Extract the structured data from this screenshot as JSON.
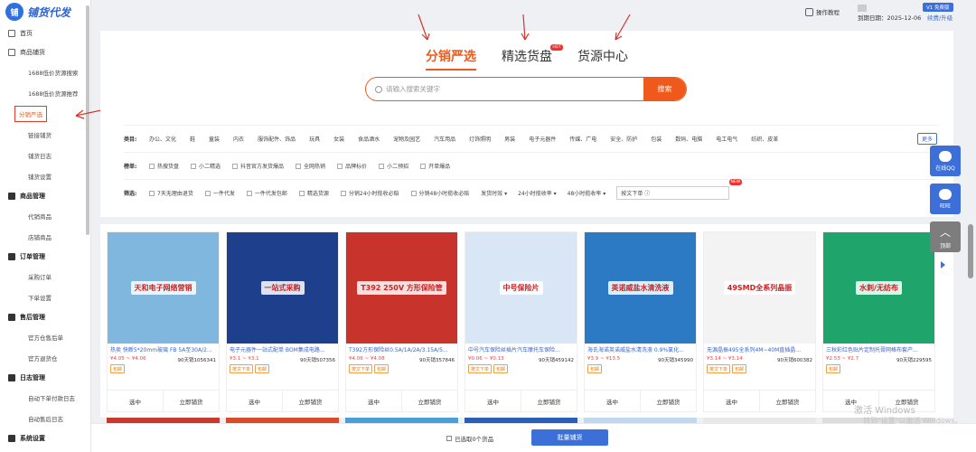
{
  "app": {
    "logo_mark": "铺",
    "name": "铺货代发"
  },
  "sidebar": {
    "home": "首页",
    "sections": [
      {
        "label": "商品铺货",
        "items": [
          "1688低价货源搜索",
          "1688低价货源推荐",
          "分销严选",
          "链接铺货",
          "铺货日志",
          "铺货设置"
        ]
      },
      {
        "label": "商品管理",
        "items": [
          "代销商品",
          "店铺商品"
        ]
      },
      {
        "label": "订单管理",
        "items": [
          "采购订单",
          "下单设置"
        ]
      },
      {
        "label": "售后管理",
        "items": [
          "官方仓售后单",
          "官方退货仓"
        ]
      },
      {
        "label": "日志管理",
        "items": [
          "自动下单付款日志",
          "自动售后日志"
        ]
      },
      {
        "label": "系统设置",
        "items": []
      }
    ]
  },
  "topbar": {
    "help": "操作教程",
    "expiry": "到期日期：2025-12-06",
    "version": "V1 免费版",
    "renew": "续费/升级"
  },
  "tabs": [
    {
      "label": "分销严选",
      "active": true
    },
    {
      "label": "精选货盘",
      "badge": "HOT"
    },
    {
      "label": "货源中心"
    }
  ],
  "search": {
    "placeholder": "请输入搜索关键字",
    "button": "搜索"
  },
  "filters": {
    "category_label": "类目:",
    "categories": [
      "办公、文化",
      "鞋",
      "童装",
      "内衣",
      "服饰配件、饰品",
      "玩具",
      "女装",
      "食品酒水",
      "宠物及园艺",
      "汽车用品",
      "灯饰照明",
      "男装",
      "电子元器件",
      "传媒、广电",
      "安全、防护",
      "包装",
      "数码、电脑",
      "电工电气",
      "纺织、皮革"
    ],
    "more": "更多",
    "list_label": "榜单:",
    "lists": [
      "热搜货盘",
      "小二精选",
      "抖音官方发货爆品",
      "全网热销",
      "品牌标价",
      "小二预招",
      "开单爆品"
    ],
    "filter_label": "筛选:",
    "options": [
      "7天无理由退货",
      "一件代发",
      "一件代发包邮",
      "精选货源",
      "分销24小时揽收必赔",
      "分销48小时揽收必赔"
    ],
    "selects": [
      "发货时效",
      "24小时揽收率",
      "48小时揽收率"
    ],
    "sort": "按文下单",
    "sort_badge": "NEW"
  },
  "products": [
    {
      "title": "热卖 快断5*20mm玻璃 FB 5A至30A/2...",
      "price": "¥4.05 ~ ¥4.06",
      "sales": "90天销1056341",
      "tags": [
        "包邮"
      ],
      "img_text": "天和电子网络营销",
      "bg": "#7fb7df"
    },
    {
      "title": "电子元器件一站式配单 BOM集成电路...",
      "price": "¥3.1 ~ ¥3.1",
      "sales": "90天销507356",
      "tags": [
        "按文下单",
        "包邮"
      ],
      "img_text": "一站式采购",
      "bg": "#1e3f8c"
    },
    {
      "title": "T392方形保险丝0.5A/1A/2A/3.15A/5...",
      "price": "¥4.06 ~ ¥4.08",
      "sales": "90天销357846",
      "tags": [
        "按文下单",
        "包邮"
      ],
      "img_text": "T392 250V 方形保险管",
      "bg": "#c8332b"
    },
    {
      "title": "中号汽车保险丝插片汽车摩托车保险...",
      "price": "¥0.06 ~ ¥0.13",
      "sales": "90天销459142",
      "tags": [
        "按文下单",
        "包邮"
      ],
      "img_text": "中号保险片",
      "bg": "#d9e6f5"
    },
    {
      "title": "海氏海诺英诺威盐水清洗液 0.9%氯化...",
      "price": "¥3.9 ~ ¥13.5",
      "sales": "90天销345990",
      "tags": [
        "包邮"
      ],
      "img_text": "英诺威盐水清洗液",
      "bg": "#2c79c4"
    },
    {
      "title": "无源晶振495全系列4M~40M直插晶...",
      "price": "¥3.14 ~ ¥3.14",
      "sales": "90天销600382",
      "tags": [
        "按文下单",
        "包邮"
      ],
      "img_text": "49SMD全系列晶振",
      "bg": "#f3f3f3"
    },
    {
      "title": "三秋彩红色贴片定制托膏网格布套产...",
      "price": "¥2.53 ~ ¥2.7",
      "sales": "90天销229595",
      "tags": [
        "包邮"
      ],
      "img_text": "水刺/无纺布",
      "bg": "#1fa56c"
    }
  ],
  "card_actions": {
    "select": "选中",
    "list": "立即铺货"
  },
  "bottom": {
    "selected": "已选取0个货品",
    "button": "批量铺货"
  },
  "floats": [
    {
      "label": "在线QQ"
    },
    {
      "label": "旺旺"
    },
    {
      "label": "顶部"
    }
  ],
  "watermark": {
    "line1": "激活 Windows",
    "line2": "转到\"设置\"以激活 Windows。"
  }
}
